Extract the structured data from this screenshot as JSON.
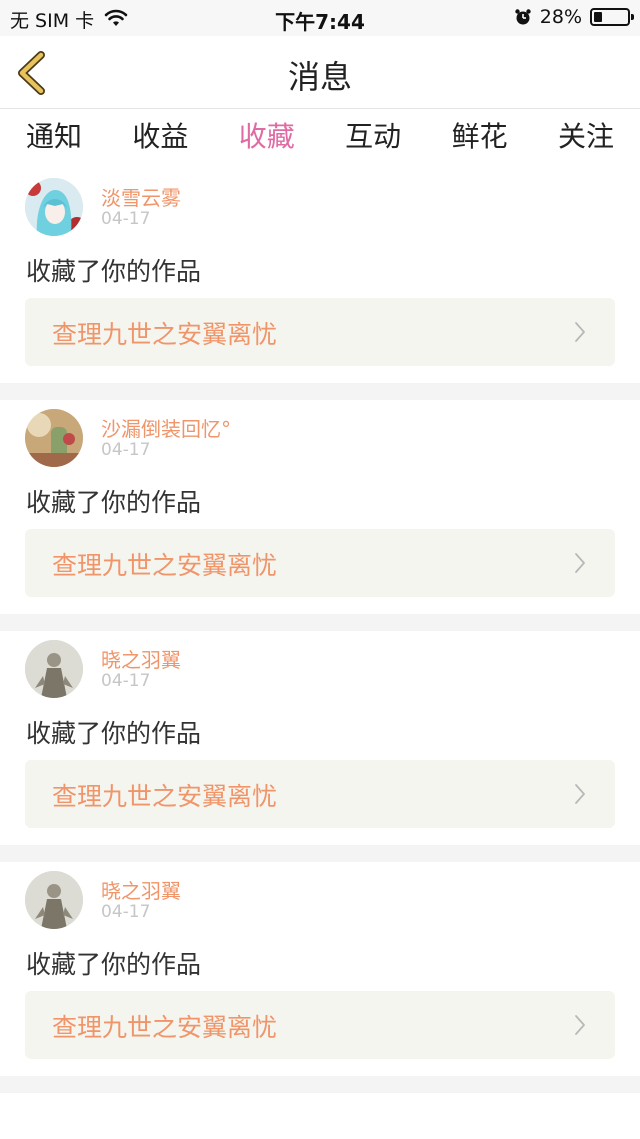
{
  "status_bar": {
    "carrier": "无 SIM 卡",
    "time": "下午7:44",
    "battery": "28%",
    "icons": [
      "wifi-icon",
      "alarm-icon",
      "battery-icon"
    ]
  },
  "nav": {
    "title": "消息",
    "back_icon": "chevron-left-icon"
  },
  "tabs": [
    {
      "label": "通知",
      "active": false
    },
    {
      "label": "收益",
      "active": false
    },
    {
      "label": "收藏",
      "active": true
    },
    {
      "label": "互动",
      "active": false
    },
    {
      "label": "鲜花",
      "active": false
    },
    {
      "label": "关注",
      "active": false
    }
  ],
  "colors": {
    "accent_pink": "#e06aa4",
    "name_orange": "#f0956a",
    "back_yellow": "#e8b54a",
    "card_bg": "#f5f5f0",
    "date_gray": "#c6c6c6"
  },
  "feed": [
    {
      "user": "淡雪云雾",
      "date": "04-17",
      "action": "收藏了你的作品",
      "work": "查理九世之安翼离忧"
    },
    {
      "user": "沙漏倒装回忆°",
      "date": "04-17",
      "action": "收藏了你的作品",
      "work": "查理九世之安翼离忧"
    },
    {
      "user": "晓之羽翼",
      "date": "04-17",
      "action": "收藏了你的作品",
      "work": "查理九世之安翼离忧"
    },
    {
      "user": "晓之羽翼",
      "date": "04-17",
      "action": "收藏了你的作品",
      "work": "查理九世之安翼离忧"
    }
  ]
}
